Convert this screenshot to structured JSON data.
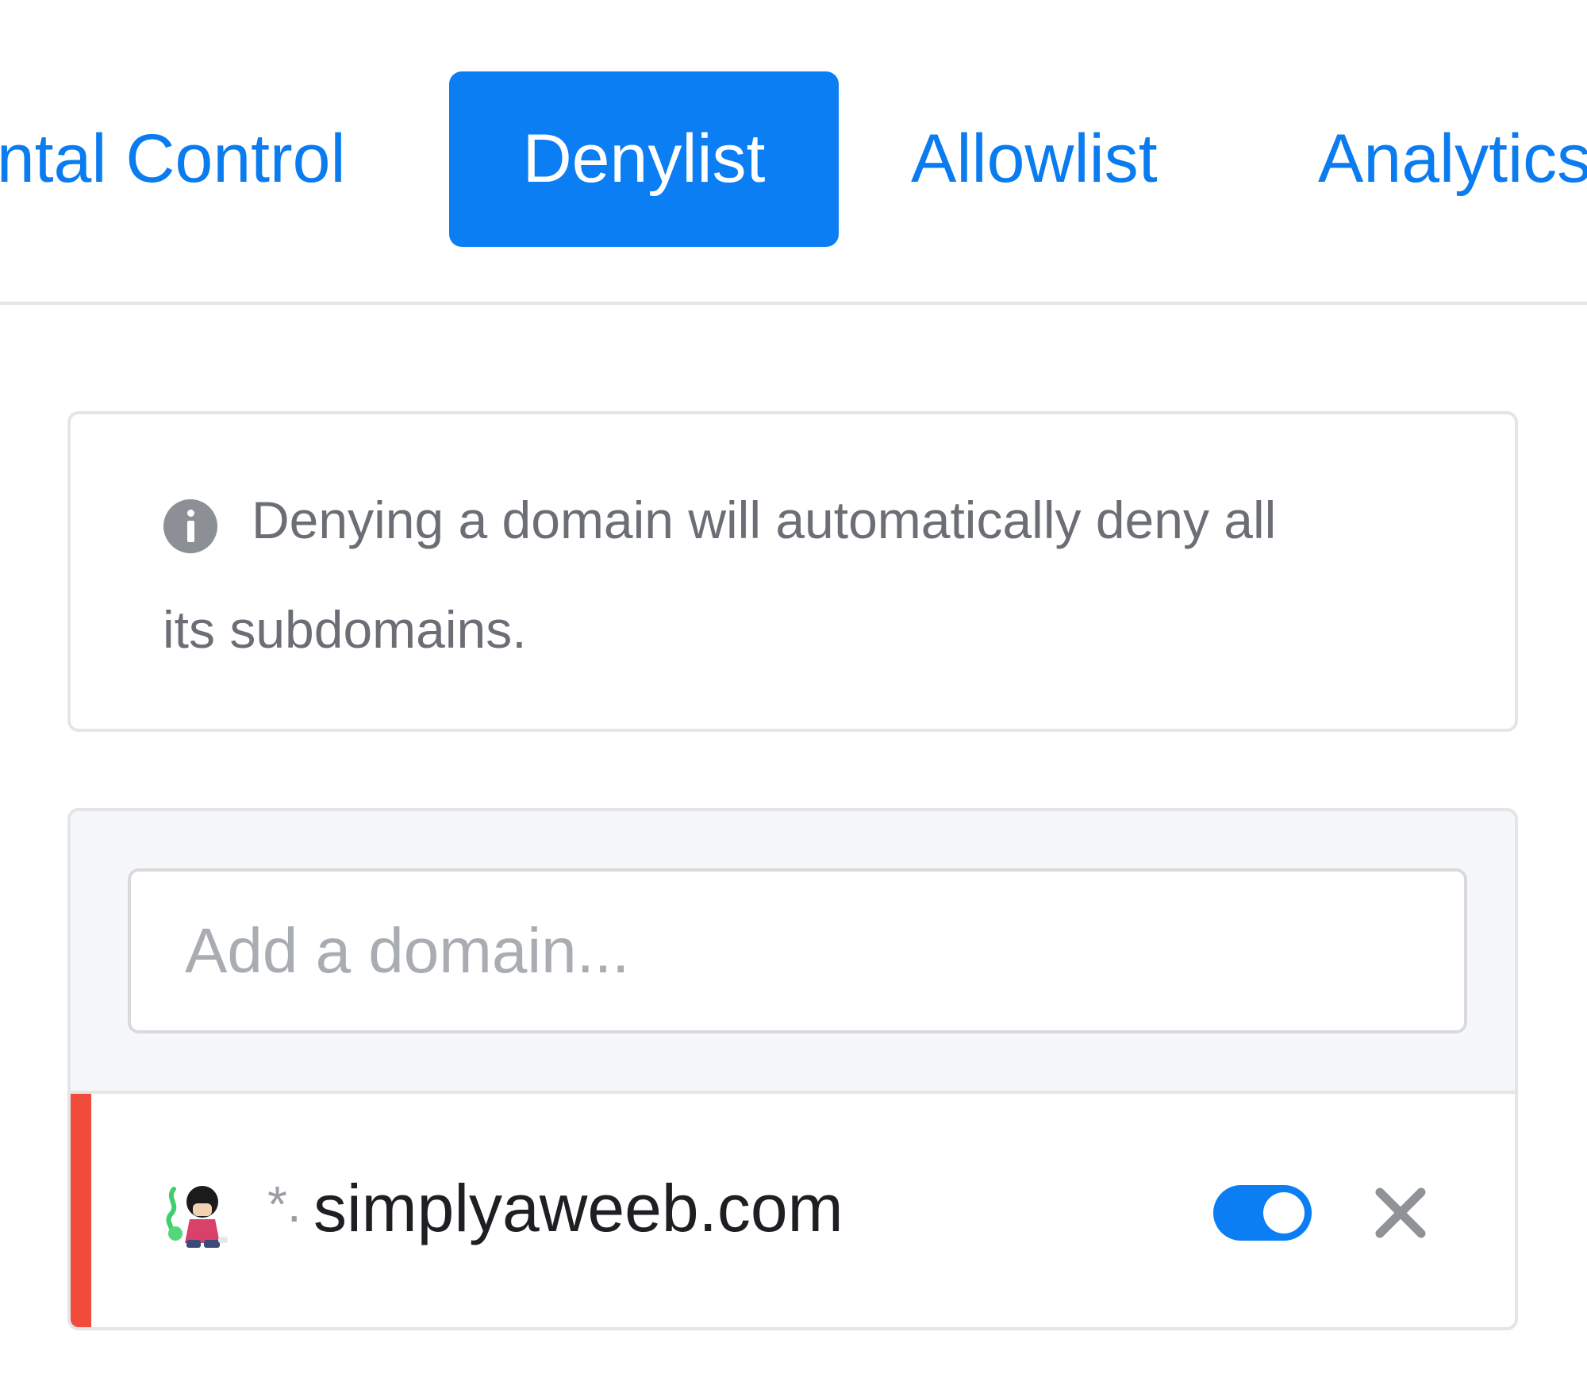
{
  "tabs": [
    {
      "label": "Parental Control",
      "visible_text": "ental Control",
      "active": false
    },
    {
      "label": "Denylist",
      "active": true
    },
    {
      "label": "Allowlist",
      "active": false
    },
    {
      "label": "Analytics",
      "active": false
    }
  ],
  "info": {
    "icon": "info-icon",
    "text_line1": "Denying a domain will automatically deny all",
    "text_line2": "its subdomains."
  },
  "add_domain": {
    "placeholder": "Add a domain...",
    "value": ""
  },
  "denylist": [
    {
      "wildcard": "*.",
      "domain": "simplyaweeb.com",
      "enabled": true,
      "status_color": "#f04b3b"
    }
  ],
  "colors": {
    "accent": "#0a7ef2",
    "deny_red": "#f04b3b",
    "muted_text": "#6b6f75"
  }
}
